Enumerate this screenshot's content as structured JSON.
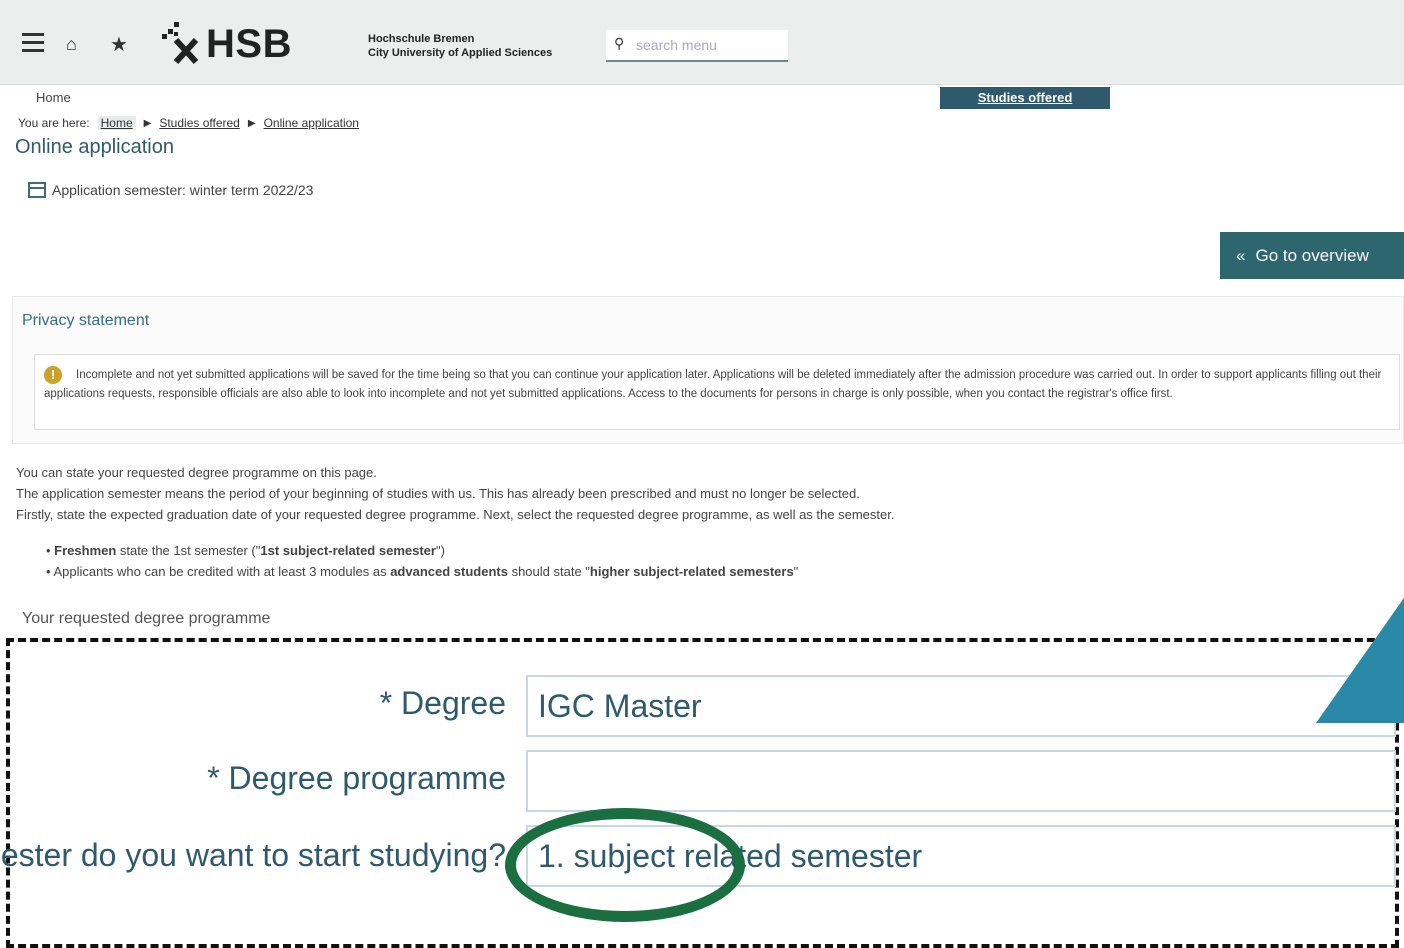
{
  "header": {
    "logo_text": "HSB",
    "logo_sub_line1": "Hochschule Bremen",
    "logo_sub_line2": "City University of Applied Sciences",
    "search_placeholder": "search menu"
  },
  "nav": {
    "home": "Home",
    "studies_offered": "Studies offered"
  },
  "breadcrumb": {
    "prefix": "You are here:",
    "items": [
      "Home",
      "Studies offered",
      "Online application"
    ]
  },
  "page": {
    "title": "Online application",
    "semester": "Application semester: winter term 2022/23",
    "overview_button": "Go to overview"
  },
  "privacy": {
    "title": "Privacy statement",
    "text": "Incomplete and not yet submitted applications will be saved for the time being so that you can continue your application later. Applications will be deleted immediately after the admission procedure was carried out. In order to support applicants filling out their applications requests, responsible officials are also able to look into incomplete and not yet submitted applications. Access to the documents for persons in charge is only possible, when you contact the registrar's office first."
  },
  "intro": {
    "line1": "You can state your requested degree programme on this page.",
    "line2": "The application semester means the period of your beginning of studies with us. This has already been prescribed and must no longer be selected.",
    "line3": "Firstly, state the expected graduation date of your requested degree programme. Next, select the requested degree programme, as well as the semester.",
    "bullet1_bold": "Freshmen",
    "bullet1_rest": " state the 1st semester (\"",
    "bullet1_bold2": "1st subject-related semester",
    "bullet1_end": "\")",
    "bullet2_start": "Applicants who can be credited with at least 3 modules as ",
    "bullet2_bold": "advanced students",
    "bullet2_mid": " should state \"",
    "bullet2_bold2": "higher subject-related semesters",
    "bullet2_end": "\""
  },
  "form": {
    "section_title": "Your requested degree programme",
    "degree_label": "* Degree",
    "degree_value": "IGC Master",
    "programme_label": "* Degree programme",
    "programme_value": "",
    "semester_label": "ester do you want to start studying?",
    "semester_value": "1. subject related semester"
  },
  "colors": {
    "accent": "#2f5a6e",
    "button": "#2e6670",
    "highlight": "#1b6e3f",
    "callout": "#2a89a6"
  }
}
